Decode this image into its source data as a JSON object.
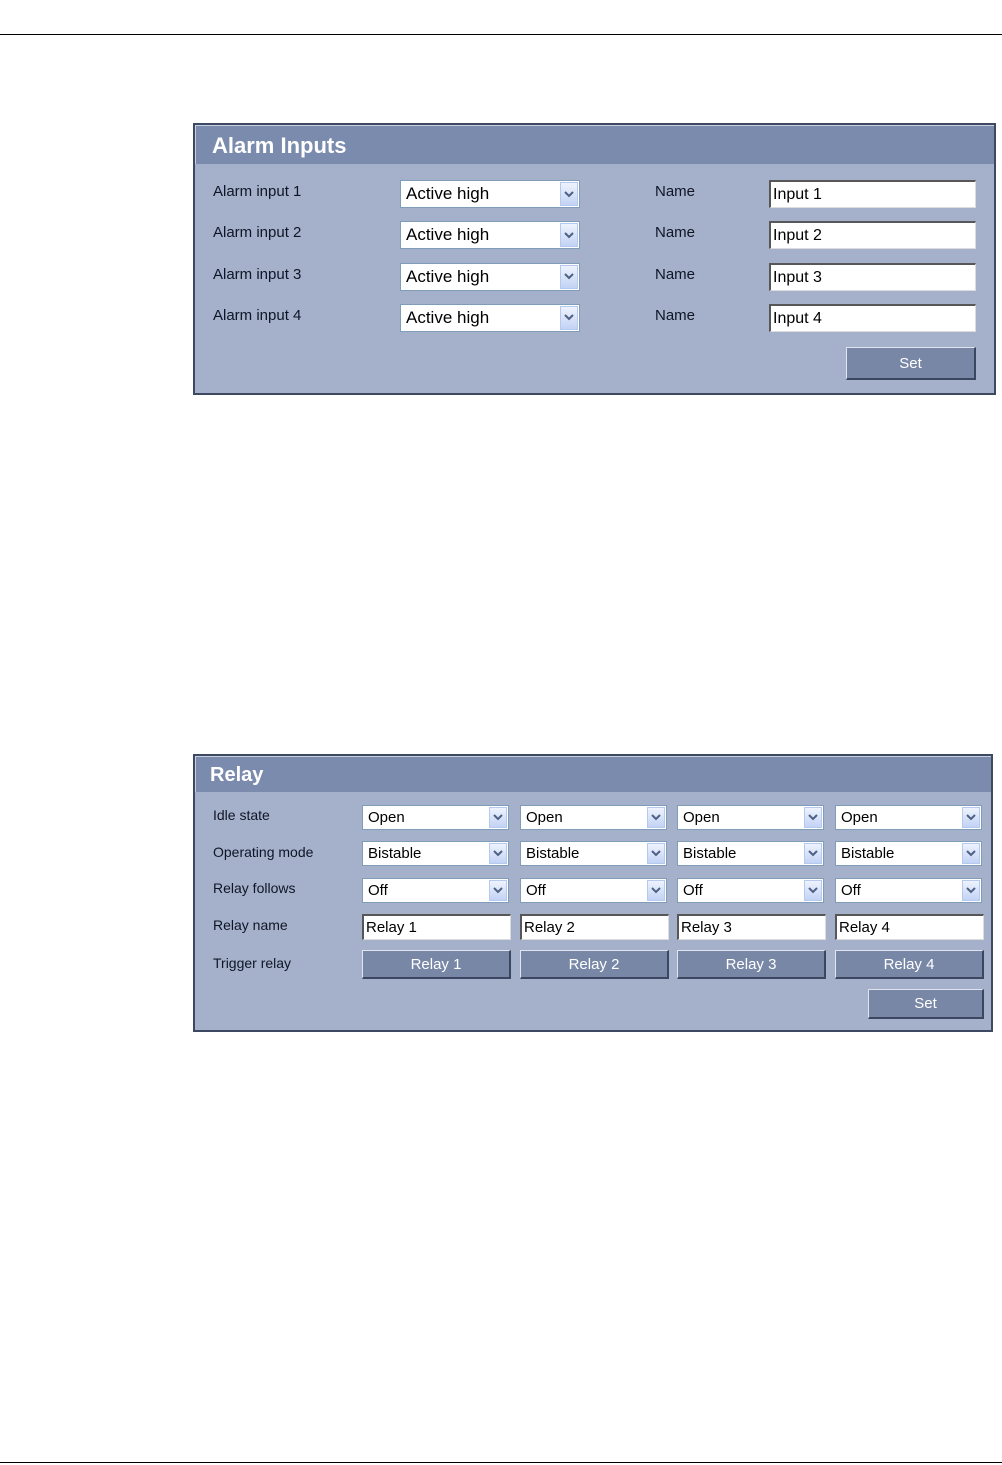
{
  "alarm_inputs": {
    "title": "Alarm Inputs",
    "rows": [
      {
        "label": "Alarm input 1",
        "state": "Active high",
        "name_label": "Name",
        "name": "Input 1"
      },
      {
        "label": "Alarm input 2",
        "state": "Active high",
        "name_label": "Name",
        "name": "Input 2"
      },
      {
        "label": "Alarm input 3",
        "state": "Active high",
        "name_label": "Name",
        "name": "Input 3"
      },
      {
        "label": "Alarm input 4",
        "state": "Active high",
        "name_label": "Name",
        "name": "Input 4"
      }
    ],
    "set_label": "Set"
  },
  "relay": {
    "title": "Relay",
    "labels": {
      "idle_state": "Idle state",
      "operating_mode": "Operating mode",
      "relay_follows": "Relay follows",
      "relay_name": "Relay name",
      "trigger_relay": "Trigger relay"
    },
    "columns": [
      {
        "idle_state": "Open",
        "operating_mode": "Bistable",
        "relay_follows": "Off",
        "name": "Relay 1",
        "trigger": "Relay 1"
      },
      {
        "idle_state": "Open",
        "operating_mode": "Bistable",
        "relay_follows": "Off",
        "name": "Relay 2",
        "trigger": "Relay 2"
      },
      {
        "idle_state": "Open",
        "operating_mode": "Bistable",
        "relay_follows": "Off",
        "name": "Relay 3",
        "trigger": "Relay 3"
      },
      {
        "idle_state": "Open",
        "operating_mode": "Bistable",
        "relay_follows": "Off",
        "name": "Relay 4",
        "trigger": "Relay 4"
      }
    ],
    "set_label": "Set"
  },
  "icons": {
    "dropdown": "chevron-down-icon"
  },
  "colors": {
    "panel_bg": "#a5b1ca",
    "title_bar": "#7a8bad",
    "button": "#7887a6",
    "panel_border": "#3d4961"
  }
}
